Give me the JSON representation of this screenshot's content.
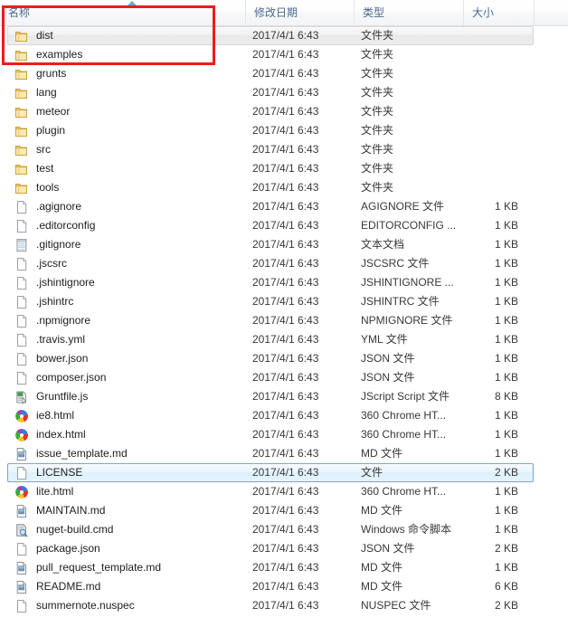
{
  "window": {
    "title": "Windows Explorer file list"
  },
  "columns": [
    {
      "key": "name",
      "label": "名称",
      "sorted": "ascending"
    },
    {
      "key": "date",
      "label": "修改日期",
      "sorted": ""
    },
    {
      "key": "type",
      "label": "类型",
      "sorted": ""
    },
    {
      "key": "size",
      "label": "大小",
      "sorted": ""
    }
  ],
  "annotation": {
    "shape": "rectangle",
    "color": "#ef1b1b",
    "covers": "名称 column header plus dist and examples rows"
  },
  "rows": [
    {
      "name": "dist",
      "date": "2017/4/1 6:43",
      "type": "文件夹",
      "size": "",
      "icon": "folder-icon",
      "state": "hover"
    },
    {
      "name": "examples",
      "date": "2017/4/1 6:43",
      "type": "文件夹",
      "size": "",
      "icon": "folder-icon",
      "state": ""
    },
    {
      "name": "grunts",
      "date": "2017/4/1 6:43",
      "type": "文件夹",
      "size": "",
      "icon": "folder-icon",
      "state": ""
    },
    {
      "name": "lang",
      "date": "2017/4/1 6:43",
      "type": "文件夹",
      "size": "",
      "icon": "folder-icon",
      "state": ""
    },
    {
      "name": "meteor",
      "date": "2017/4/1 6:43",
      "type": "文件夹",
      "size": "",
      "icon": "folder-icon",
      "state": ""
    },
    {
      "name": "plugin",
      "date": "2017/4/1 6:43",
      "type": "文件夹",
      "size": "",
      "icon": "folder-icon",
      "state": ""
    },
    {
      "name": "src",
      "date": "2017/4/1 6:43",
      "type": "文件夹",
      "size": "",
      "icon": "folder-icon",
      "state": ""
    },
    {
      "name": "test",
      "date": "2017/4/1 6:43",
      "type": "文件夹",
      "size": "",
      "icon": "folder-icon",
      "state": ""
    },
    {
      "name": "tools",
      "date": "2017/4/1 6:43",
      "type": "文件夹",
      "size": "",
      "icon": "folder-icon",
      "state": ""
    },
    {
      "name": ".agignore",
      "date": "2017/4/1 6:43",
      "type": "AGIGNORE 文件",
      "size": "1 KB",
      "icon": "blank-file-icon",
      "state": ""
    },
    {
      "name": ".editorconfig",
      "date": "2017/4/1 6:43",
      "type": "EDITORCONFIG ...",
      "size": "1 KB",
      "icon": "blank-file-icon",
      "state": ""
    },
    {
      "name": ".gitignore",
      "date": "2017/4/1 6:43",
      "type": "文本文档",
      "size": "1 KB",
      "icon": "text-file-icon",
      "state": ""
    },
    {
      "name": ".jscsrc",
      "date": "2017/4/1 6:43",
      "type": "JSCSRC 文件",
      "size": "1 KB",
      "icon": "blank-file-icon",
      "state": ""
    },
    {
      "name": ".jshintignore",
      "date": "2017/4/1 6:43",
      "type": "JSHINTIGNORE ...",
      "size": "1 KB",
      "icon": "blank-file-icon",
      "state": ""
    },
    {
      "name": ".jshintrc",
      "date": "2017/4/1 6:43",
      "type": "JSHINTRC 文件",
      "size": "1 KB",
      "icon": "blank-file-icon",
      "state": ""
    },
    {
      "name": ".npmignore",
      "date": "2017/4/1 6:43",
      "type": "NPMIGNORE 文件",
      "size": "1 KB",
      "icon": "blank-file-icon",
      "state": ""
    },
    {
      "name": ".travis.yml",
      "date": "2017/4/1 6:43",
      "type": "YML 文件",
      "size": "1 KB",
      "icon": "blank-file-icon",
      "state": ""
    },
    {
      "name": "bower.json",
      "date": "2017/4/1 6:43",
      "type": "JSON 文件",
      "size": "1 KB",
      "icon": "blank-file-icon",
      "state": ""
    },
    {
      "name": "composer.json",
      "date": "2017/4/1 6:43",
      "type": "JSON 文件",
      "size": "1 KB",
      "icon": "blank-file-icon",
      "state": ""
    },
    {
      "name": "Gruntfile.js",
      "date": "2017/4/1 6:43",
      "type": "JScript Script 文件",
      "size": "8 KB",
      "icon": "jscript-file-icon",
      "state": ""
    },
    {
      "name": "ie8.html",
      "date": "2017/4/1 6:43",
      "type": "360 Chrome HT...",
      "size": "1 KB",
      "icon": "chrome360-icon",
      "state": ""
    },
    {
      "name": "index.html",
      "date": "2017/4/1 6:43",
      "type": "360 Chrome HT...",
      "size": "1 KB",
      "icon": "chrome360-icon",
      "state": ""
    },
    {
      "name": "issue_template.md",
      "date": "2017/4/1 6:43",
      "type": "MD 文件",
      "size": "1 KB",
      "icon": "markdown-file-icon",
      "state": ""
    },
    {
      "name": "LICENSE",
      "date": "2017/4/1 6:43",
      "type": "文件",
      "size": "2 KB",
      "icon": "blank-file-icon",
      "state": "selected"
    },
    {
      "name": "lite.html",
      "date": "2017/4/1 6:43",
      "type": "360 Chrome HT...",
      "size": "1 KB",
      "icon": "chrome360-icon",
      "state": ""
    },
    {
      "name": "MAINTAIN.md",
      "date": "2017/4/1 6:43",
      "type": "MD 文件",
      "size": "1 KB",
      "icon": "markdown-file-icon",
      "state": ""
    },
    {
      "name": "nuget-build.cmd",
      "date": "2017/4/1 6:43",
      "type": "Windows 命令脚本",
      "size": "1 KB",
      "icon": "cmd-script-icon",
      "state": ""
    },
    {
      "name": "package.json",
      "date": "2017/4/1 6:43",
      "type": "JSON 文件",
      "size": "2 KB",
      "icon": "blank-file-icon",
      "state": ""
    },
    {
      "name": "pull_request_template.md",
      "date": "2017/4/1 6:43",
      "type": "MD 文件",
      "size": "1 KB",
      "icon": "markdown-file-icon",
      "state": ""
    },
    {
      "name": "README.md",
      "date": "2017/4/1 6:43",
      "type": "MD 文件",
      "size": "6 KB",
      "icon": "markdown-file-icon",
      "state": ""
    },
    {
      "name": "summernote.nuspec",
      "date": "2017/4/1 6:43",
      "type": "NUSPEC 文件",
      "size": "2 KB",
      "icon": "blank-file-icon",
      "state": ""
    }
  ]
}
